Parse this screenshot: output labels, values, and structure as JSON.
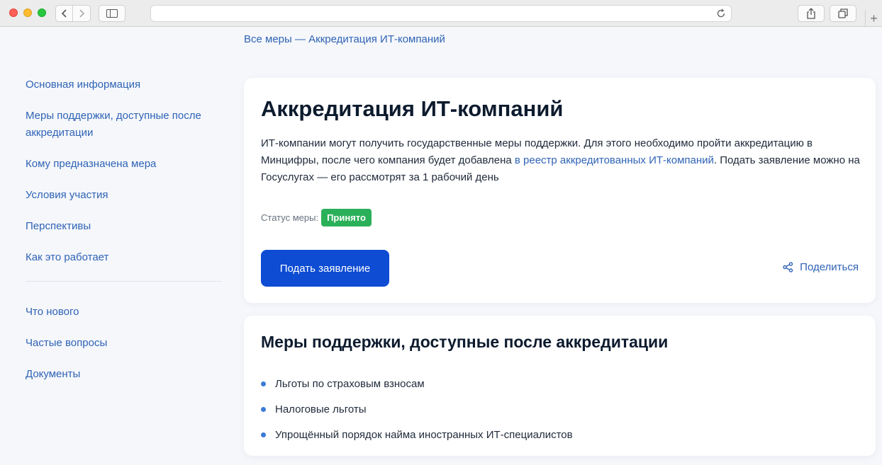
{
  "breadcrumb": {
    "text": "Все меры — Аккредитация ИТ-компаний"
  },
  "sidebar": {
    "items": [
      {
        "label": "Основная информация"
      },
      {
        "label": "Меры поддержки, доступные после аккредитации"
      },
      {
        "label": "Кому предназначена мера"
      },
      {
        "label": "Условия участия"
      },
      {
        "label": "Перспективы"
      },
      {
        "label": "Как это работает"
      }
    ],
    "secondary": [
      {
        "label": "Что нового"
      },
      {
        "label": "Частые вопросы"
      },
      {
        "label": "Документы"
      }
    ]
  },
  "main": {
    "title": "Аккредитация ИТ-компаний",
    "description_part1": "ИТ-компании могут получить государственные меры поддержки. Для этого необходимо пройти аккредитацию в Минцифры, после чего компания будет добавлена ",
    "description_link": "в реестр аккредитованных ИТ-компаний",
    "description_part2": ". Подать заявление можно на Госуслугах — его рассмотрят за 1 рабочий день",
    "status_label": "Статус меры:",
    "status_value": "Принято",
    "apply_label": "Подать заявление",
    "share_label": "Поделиться"
  },
  "support": {
    "title": "Меры поддержки, доступные после аккредитации",
    "items": [
      "Льготы по страховым взносам",
      "Налоговые льготы",
      "Упрощённый порядок найма иностранных ИТ-специалистов"
    ]
  },
  "icons": {
    "share": "share-icon",
    "reload": "reload-icon",
    "back": "chevron-left-icon",
    "forward": "chevron-right-icon"
  },
  "colors": {
    "accent": "#0d4cd3",
    "link": "#2f63b5",
    "status_green": "#2bb05a",
    "background": "#f5f7fb"
  }
}
